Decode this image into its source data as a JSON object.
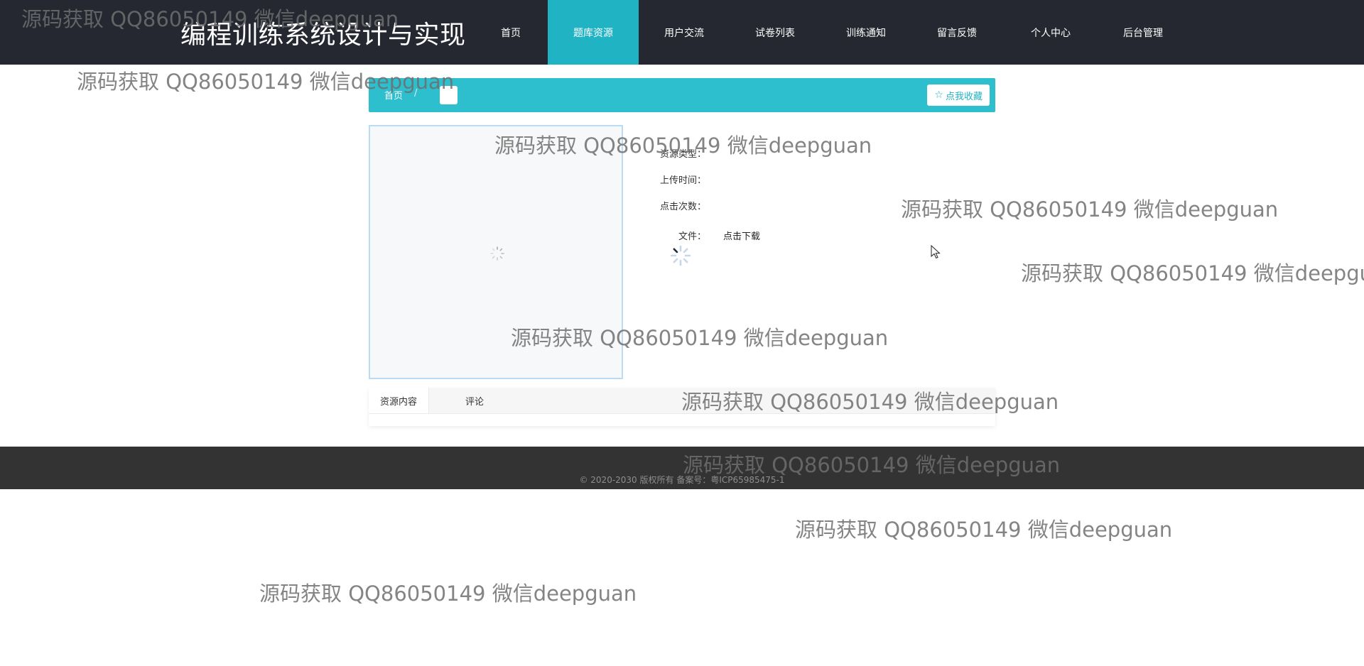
{
  "header": {
    "site_title": "编程训练系统设计与实现",
    "nav": [
      {
        "label": "首页"
      },
      {
        "label": "题库资源"
      },
      {
        "label": "用户交流"
      },
      {
        "label": "试卷列表"
      },
      {
        "label": "训练通知"
      },
      {
        "label": "留言反馈"
      },
      {
        "label": "个人中心"
      },
      {
        "label": "后台管理"
      }
    ],
    "active_nav": "题库资源",
    "bg_color": "#252830",
    "accent_color": "#20b3c4"
  },
  "breadcrumb": {
    "home": "首页",
    "separator": "/",
    "favorite_label": "点我收藏",
    "favorite_icon": "star-outline-icon"
  },
  "details": {
    "type_label": "资源类型：",
    "time_label": "上传时间：",
    "clicks_label": "点击次数：",
    "file_label": "文件：",
    "download_label": "点击下载"
  },
  "tabs": [
    {
      "label": "资源内容"
    },
    {
      "label": "评论"
    }
  ],
  "footer": {
    "text": "© 2020-2030 版权所有 备案号：粤ICP65985475-1"
  },
  "watermark": {
    "text": "源码获取 QQ86050149 微信deepguan"
  }
}
